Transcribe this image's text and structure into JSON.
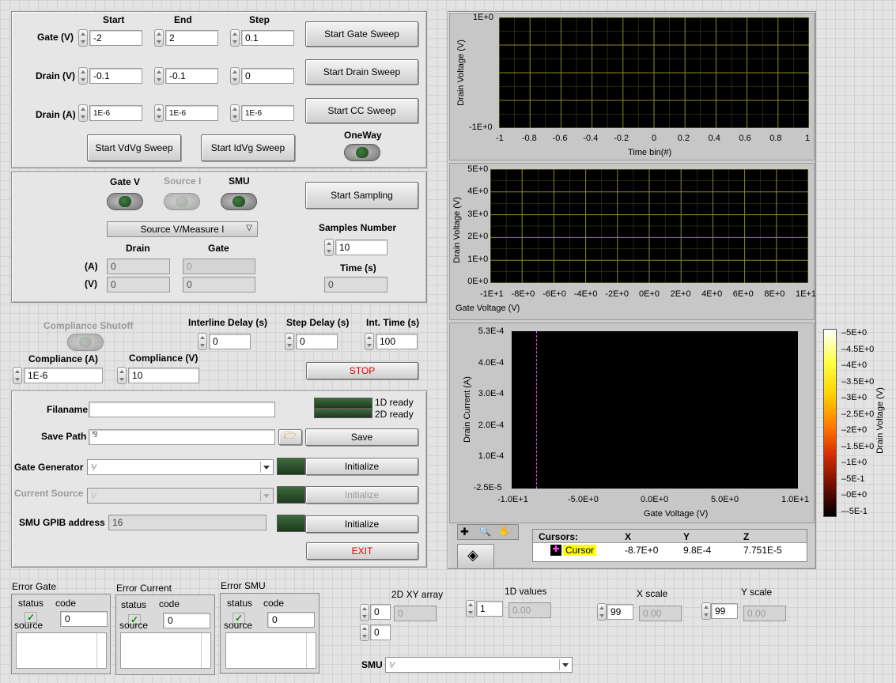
{
  "sweep": {
    "col_start": "Start",
    "col_end": "End",
    "col_step": "Step",
    "gate_label": "Gate (V)",
    "gate_start": "-2",
    "gate_end": "2",
    "gate_step": "0.1",
    "drainv_label": "Drain (V)",
    "drainv_start": "-0.1",
    "drainv_end": "-0.1",
    "drainv_step": "0",
    "draina_label": "Drain (A)",
    "draina_start": "1E-6",
    "draina_end": "1E-6",
    "draina_step": "1E-6",
    "btn_gate": "Start Gate Sweep",
    "btn_drain": "Start Drain Sweep",
    "btn_cc": "Start CC Sweep",
    "btn_vdvg": "Start VdVg Sweep",
    "btn_idvg": "Start IdVg Sweep",
    "oneway_label": "OneWay"
  },
  "sampling": {
    "gatev_label": "Gate V",
    "sourcei_label": "Source I",
    "smu_label": "SMU",
    "mode": "Source V/Measure I",
    "col_drain": "Drain",
    "col_gate": "Gate",
    "row_a": "(A)",
    "row_v": "(V)",
    "drain_a": "0",
    "gate_a": "0",
    "drain_v": "0",
    "gate_v": "0",
    "btn_sampling": "Start Sampling",
    "samples_label": "Samples Number",
    "samples": "10",
    "time_label": "Time (s)",
    "time": "0"
  },
  "settings": {
    "compliance_shutoff": "Compliance Shutoff",
    "interline_label": "Interline Delay (s)",
    "interline": "0",
    "stepdelay_label": "Step Delay (s)",
    "stepdelay": "0",
    "inttime_label": "Int. Time (s)",
    "inttime": "100",
    "compa_label": "Compliance (A)",
    "compa": "1E-6",
    "compv_label": "Compliance (V)",
    "compv": "10",
    "stop": "STOP"
  },
  "files": {
    "filename_label": "Filaname",
    "filename": "",
    "savepath_label": "Save Path",
    "savepath": "",
    "ready1": "1D ready",
    "ready2": "2D ready",
    "save": "Save",
    "gategen_label": "Gate Generator",
    "gategen": "",
    "cursrc_label": "Current Source",
    "cursrc": "",
    "smugpib_label": "SMU GPIB address",
    "smugpib": "16",
    "initialize": "Initialize",
    "exit": "EXIT"
  },
  "graph1": {
    "ylabel": "Drain Voltage (V)",
    "xlabel": "Time bin(#)",
    "yticks": [
      "1E+0",
      "-1E+0"
    ],
    "xticks": [
      "-1",
      "-0.8",
      "-0.6",
      "-0.4",
      "-0.2",
      "0",
      "0.2",
      "0.4",
      "0.6",
      "0.8",
      "1"
    ]
  },
  "graph2": {
    "ylabel": "Drain Voltage (V)",
    "xlabel": "Gate Voltage (V)",
    "yticks": [
      "5E+0",
      "4E+0",
      "3E+0",
      "2E+0",
      "1E+0",
      "0E+0"
    ],
    "xticks": [
      "-1E+1",
      "-8E+0",
      "-6E+0",
      "-4E+0",
      "-2E+0",
      "0E+0",
      "2E+0",
      "4E+0",
      "6E+0",
      "8E+0",
      "1E+1"
    ]
  },
  "graph3": {
    "ylabel": "Drain Current (A)",
    "xlabel": "Gate Voltage (V)",
    "yticks": [
      "5.3E-4",
      "4.0E-4",
      "3.0E-4",
      "2.0E-4",
      "1.0E-4",
      "-2.5E-5"
    ],
    "xticks": [
      "-1.0E+1",
      "-5.0E+0",
      "0.0E+0",
      "5.0E+0",
      "1.0E+1"
    ],
    "colorbar_title": "Drain Voltage (V)",
    "colorbar_ticks": [
      "5E+0",
      "4.5E+0",
      "4E+0",
      "3.5E+0",
      "3E+0",
      "2.5E+0",
      "2E+0",
      "1.5E+0",
      "1E+0",
      "5E-1",
      "0E+0",
      "-5E-1"
    ],
    "cursors_header": "Cursors:",
    "col_x": "X",
    "col_y": "Y",
    "col_z": "Z",
    "cursor_name": "Cursor",
    "cursor_x": "-8.7E+0",
    "cursor_y": "9.8E-4",
    "cursor_z": "7.751E-5"
  },
  "errors": {
    "gate_title": "Error Gate",
    "current_title": "Error Current",
    "smu_title": "Error SMU",
    "status": "status",
    "code": "code",
    "source": "source",
    "code_val": "0"
  },
  "bottom": {
    "arr2d_label": "2D XY array",
    "arr2d_i0": "0",
    "arr2d_i1": "0",
    "arr2d_val": "0",
    "vals1d_label": "1D values",
    "vals1d_i": "1",
    "vals1d_val": "0.00",
    "xscale_label": "X scale",
    "xscale_i": "99",
    "xscale_val": "0.00",
    "yscale_label": "Y scale",
    "yscale_i": "99",
    "yscale_val": "0.00",
    "smu_label": "SMU",
    "smu_val": ""
  },
  "colors": {
    "grid_yellow": "#8a8a22",
    "cursor_magenta": "#ff40ff",
    "stop_red": "#e00000",
    "cursor_highlight": "#ffff00"
  }
}
